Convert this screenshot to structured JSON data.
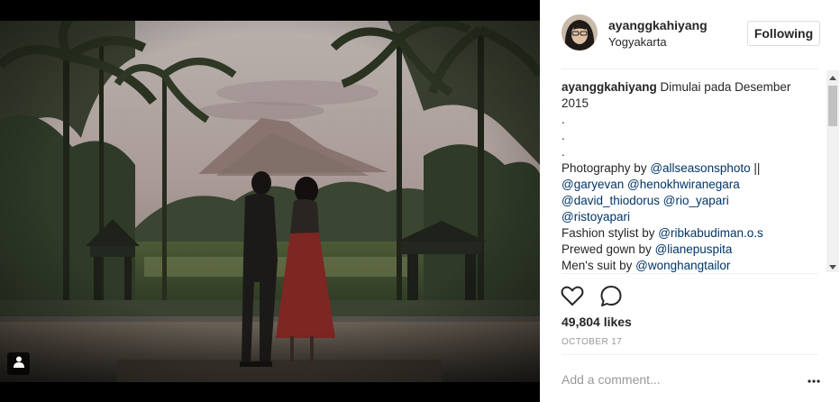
{
  "post": {
    "username": "ayanggkahiyang",
    "location": "Yogyakarta",
    "follow_label": "Following"
  },
  "caption": {
    "author": "ayanggkahiyang",
    "first_text": " Dimulai pada Desember",
    "line2": "2015",
    "dot1": ".",
    "dot2": ".",
    "dot3": ".",
    "photo_prefix": "Photography by ",
    "photo_mention": "@allseasonsphoto",
    "photo_suffix": " ||",
    "mention_gary": "@garyevan",
    "mention_henok": "@henokhwiranegara",
    "mention_david": "@david_thiodorus",
    "mention_rio": "@rio_yapari",
    "mention_risto": "@ristoyapari",
    "fashion_prefix": "Fashion stylist by ",
    "fashion_mention": "@ribkabudiman.o.s",
    "gown_prefix": "Prewed gown by ",
    "gown_mention": "@lianepuspita",
    "suit_prefix": "Men's suit by ",
    "suit_mention": "@wonghangtailor"
  },
  "stats": {
    "likes": "49,804 likes",
    "date": "OCTOBER 17"
  },
  "comment": {
    "placeholder": "Add a comment..."
  },
  "icons": {
    "like": "heart-icon",
    "comment": "comment-bubble-icon",
    "more": "ellipsis-icon",
    "tag": "user-tag-icon",
    "scroll_up": "scroll-up-arrow-icon",
    "scroll_down": "scroll-down-arrow-icon"
  }
}
